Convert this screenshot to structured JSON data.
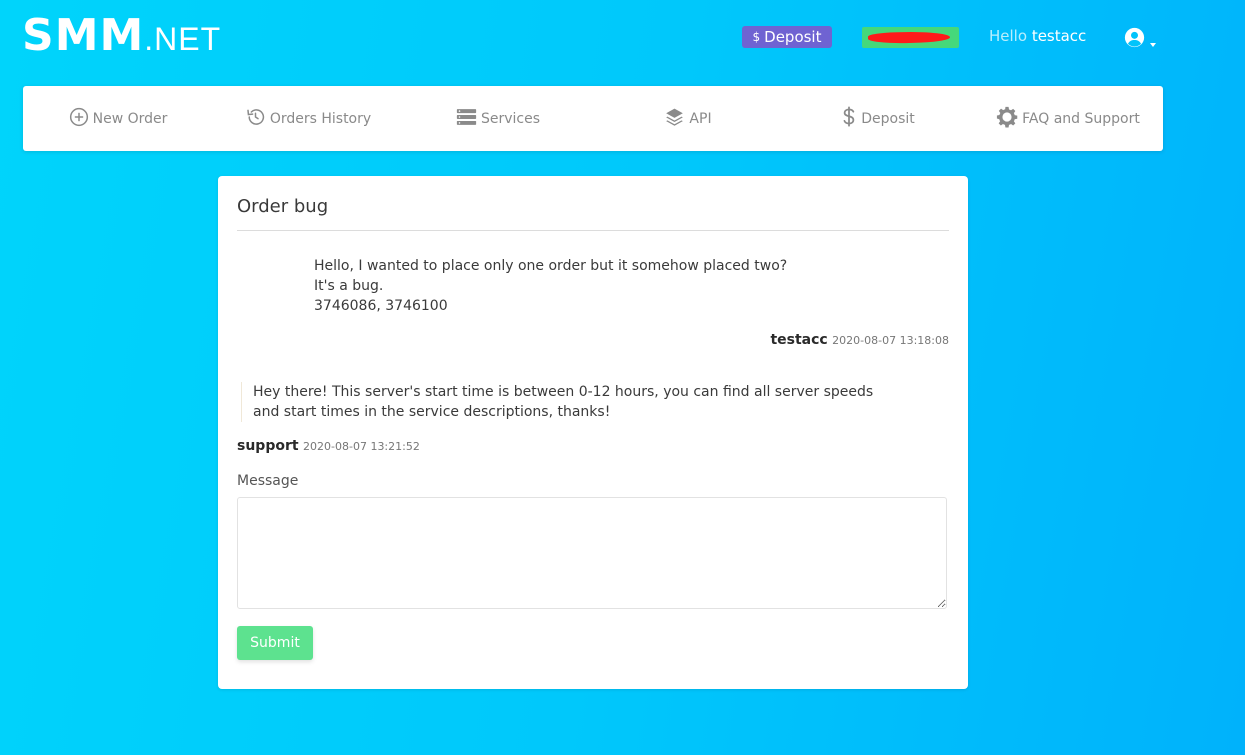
{
  "header": {
    "logo_main": "SMM",
    "logo_suffix": ".NET",
    "deposit_button": {
      "currency_symbol": "$",
      "label": "Deposit",
      "color": "#6f63d2"
    },
    "balance_badge": {
      "value": "",
      "color": "#45d87b",
      "redacted": true
    },
    "greeting": "Hello",
    "username": "testacc",
    "user_icon": "user-circle-icon"
  },
  "nav": {
    "items": [
      {
        "label": "New Order",
        "icon": "plus-circle-icon"
      },
      {
        "label": "Orders History",
        "icon": "history-icon"
      },
      {
        "label": "Services",
        "icon": "server-icon"
      },
      {
        "label": "API",
        "icon": "layers-icon"
      },
      {
        "label": "Deposit",
        "icon": "dollar-icon"
      },
      {
        "label": "FAQ and Support",
        "icon": "gear-icon"
      }
    ]
  },
  "ticket": {
    "subject": "Order bug",
    "messages": [
      {
        "lines": [
          "Hello, I wanted to place only one order but it somehow placed two?",
          "It's a bug.",
          "3746086, 3746100"
        ],
        "author": "testacc",
        "timestamp": "2020-08-07 13:18:08"
      },
      {
        "lines": [
          "Hey there! This server's start time is between 0-12 hours, you can find all server speeds",
          "and start times in the service descriptions, thanks!"
        ],
        "author": "support",
        "timestamp": "2020-08-07 13:21:52"
      }
    ],
    "form": {
      "message_label": "Message",
      "message_value": "",
      "submit_label": "Submit",
      "submit_color": "#5de28f"
    }
  },
  "colors": {
    "background_start": "#00d4fb",
    "background_end": "#00b2fb"
  }
}
